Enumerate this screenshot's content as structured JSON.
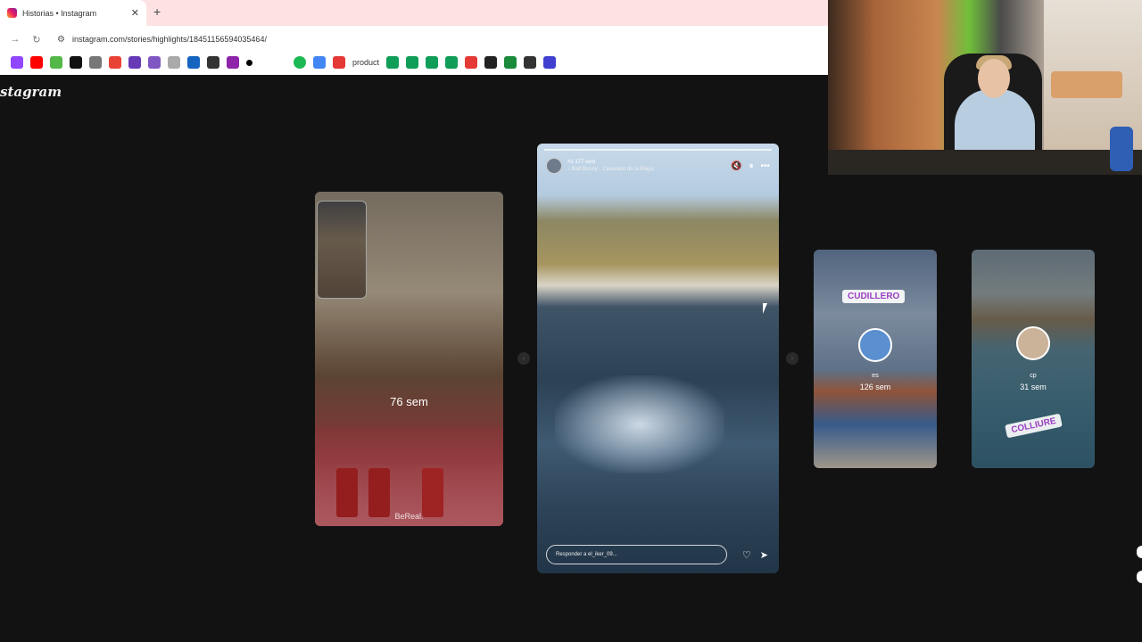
{
  "browser": {
    "tab_title": "Historias • Instagram",
    "tab_close": "✕",
    "new_tab": "+",
    "url": "instagram.com/stories/highlights/18451156594035464/",
    "bookmarks_text": "product"
  },
  "page": {
    "logo": "stagram"
  },
  "stories": {
    "previous": {
      "time_ago": "76 sem",
      "watermark": "BeReal."
    },
    "current": {
      "user": "#1  177 sem",
      "song": "♪ Bad Bunny · Cesurado de la Playa",
      "reply_placeholder": "Responder a el_iker_09..."
    },
    "next1": {
      "location": "CUDILLERO",
      "user": "es",
      "time_ago": "126 sem"
    },
    "next2": {
      "location": "COLLIURE",
      "user": "cp",
      "time_ago": "31 sem"
    }
  },
  "icons": {
    "mute": "🔇",
    "pause": "⏸",
    "more": "•••",
    "heart": "♡",
    "send": "➤",
    "prev_arrow": "‹",
    "next_arrow": "›"
  },
  "colors": {
    "page_bg": "#121212",
    "tabstrip_bg": "#fde2e4",
    "location_text": "#9b3ec2"
  }
}
